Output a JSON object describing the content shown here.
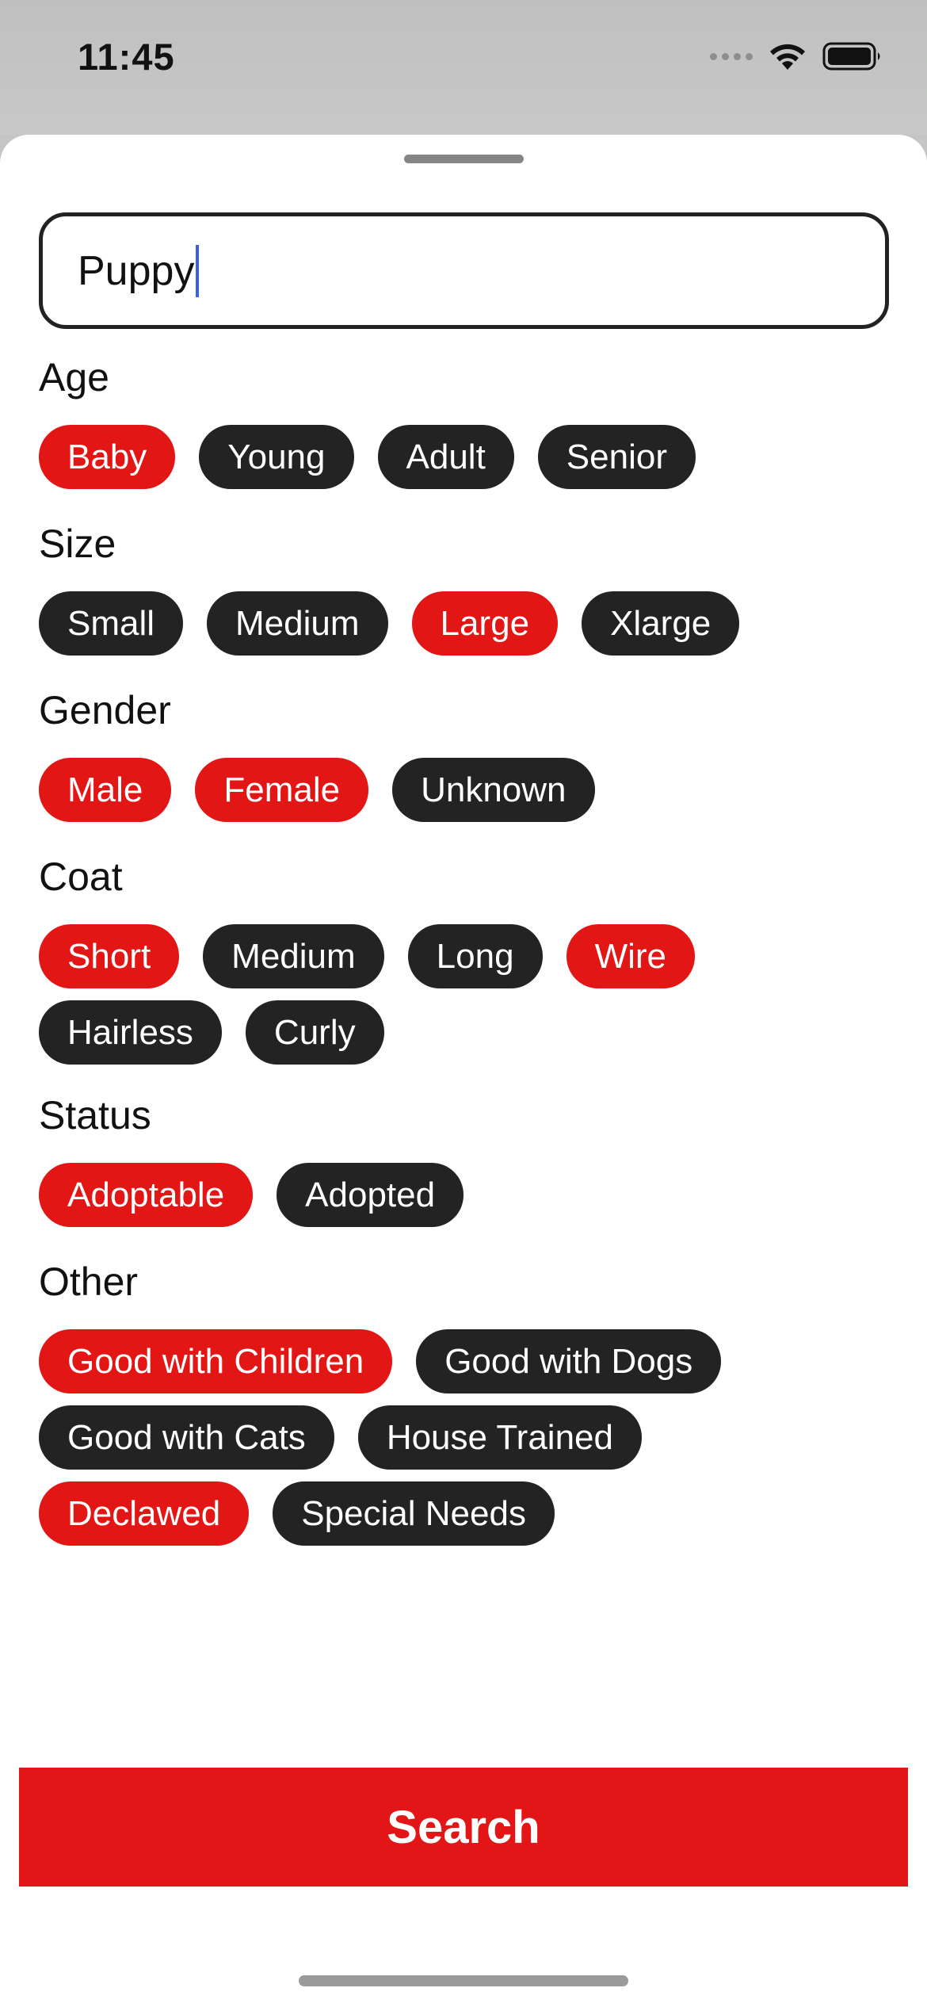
{
  "status_bar": {
    "time": "11:45"
  },
  "search": {
    "value": "Puppy"
  },
  "filters": {
    "age": {
      "label": "Age",
      "chips": [
        {
          "label": "Baby",
          "selected": true
        },
        {
          "label": "Young",
          "selected": false
        },
        {
          "label": "Adult",
          "selected": false
        },
        {
          "label": "Senior",
          "selected": false
        }
      ]
    },
    "size": {
      "label": "Size",
      "chips": [
        {
          "label": "Small",
          "selected": false
        },
        {
          "label": "Medium",
          "selected": false
        },
        {
          "label": "Large",
          "selected": true
        },
        {
          "label": "Xlarge",
          "selected": false
        }
      ]
    },
    "gender": {
      "label": "Gender",
      "chips": [
        {
          "label": "Male",
          "selected": true
        },
        {
          "label": "Female",
          "selected": true
        },
        {
          "label": "Unknown",
          "selected": false
        }
      ]
    },
    "coat": {
      "label": "Coat",
      "chips": [
        {
          "label": "Short",
          "selected": true
        },
        {
          "label": "Medium",
          "selected": false
        },
        {
          "label": "Long",
          "selected": false
        },
        {
          "label": "Wire",
          "selected": true
        },
        {
          "label": "Hairless",
          "selected": false
        },
        {
          "label": "Curly",
          "selected": false
        }
      ]
    },
    "status": {
      "label": "Status",
      "chips": [
        {
          "label": "Adoptable",
          "selected": true
        },
        {
          "label": "Adopted",
          "selected": false
        }
      ]
    },
    "other": {
      "label": "Other",
      "chips": [
        {
          "label": "Good with Children",
          "selected": true
        },
        {
          "label": "Good with Dogs",
          "selected": false
        },
        {
          "label": "Good with Cats",
          "selected": false
        },
        {
          "label": "House Trained",
          "selected": false
        },
        {
          "label": "Declawed",
          "selected": true
        },
        {
          "label": "Special Needs",
          "selected": false
        }
      ]
    }
  },
  "search_button": {
    "label": "Search"
  },
  "colors": {
    "selected_chip": "#e31616",
    "unselected_chip": "#232323",
    "search_button": "#e21616",
    "caret": "#3a62e0"
  }
}
